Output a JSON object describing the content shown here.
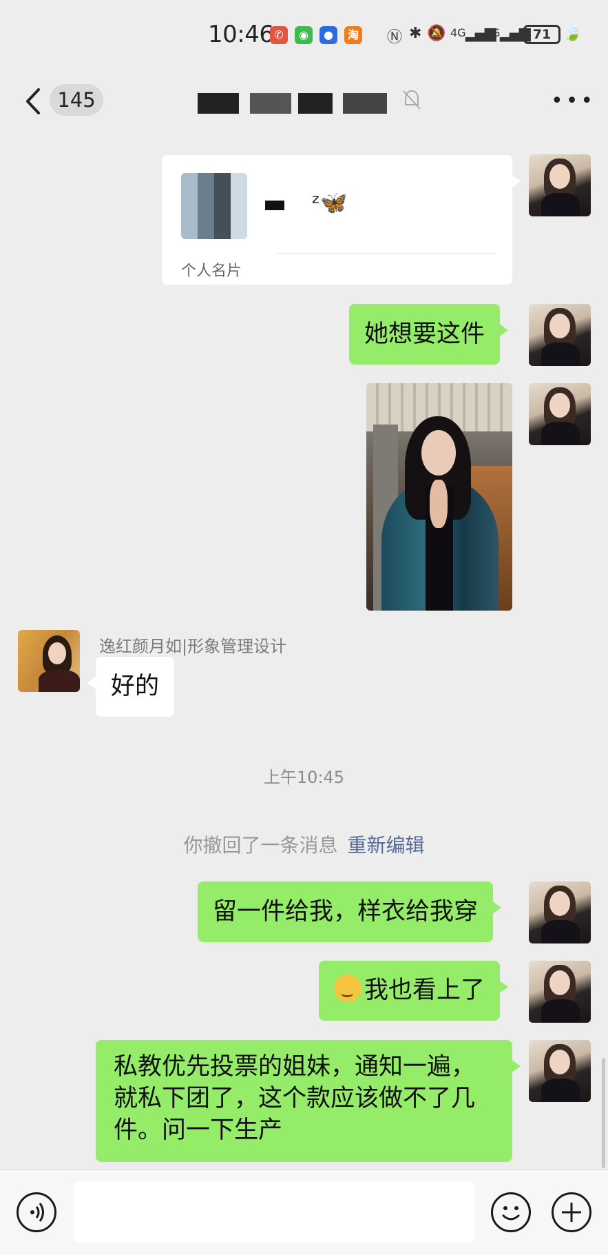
{
  "status_bar": {
    "time": "10:46",
    "battery": "71",
    "network_1": "4G",
    "network_2": "4G",
    "notif_icons": [
      "phone-missed-icon",
      "wechat-icon",
      "app-blue-icon",
      "taobao-icon"
    ],
    "taobao_label": "淘",
    "system_icons": [
      "nfc-icon",
      "bluetooth-icon",
      "mute-icon",
      "signal-icon",
      "battery-icon",
      "leaf-icon"
    ]
  },
  "header": {
    "unread_count": "145",
    "muted_icon": "bell-slash-icon",
    "more_icon": "ellipsis-icon"
  },
  "messages": {
    "card": {
      "name_suffix": "ᶻ🦋",
      "label": "个人名片"
    },
    "msg1": "她想要这件",
    "other_sender": "逸红颜月如|形象管理设计",
    "other_reply": "好的",
    "time_separator": "上午10:45",
    "recall_text": "你撤回了一条消息",
    "recall_edit": "重新编辑",
    "msg2": "留一件给我，样衣给我穿",
    "msg3": "我也看上了",
    "msg4_line1": "私教优先投票的姐妹，通知一遍，",
    "msg4_line2": "就私下团了，这个款应该做不了几",
    "msg4_line3": "件。问一下生产"
  },
  "input_bar": {
    "voice_icon": "voice-icon",
    "emoji_icon": "emoji-icon",
    "plus_icon": "plus-icon",
    "input_value": ""
  },
  "colors": {
    "background": "#ededed",
    "my_bubble": "#95ec69",
    "other_bubble": "#ffffff",
    "link": "#576b95"
  }
}
